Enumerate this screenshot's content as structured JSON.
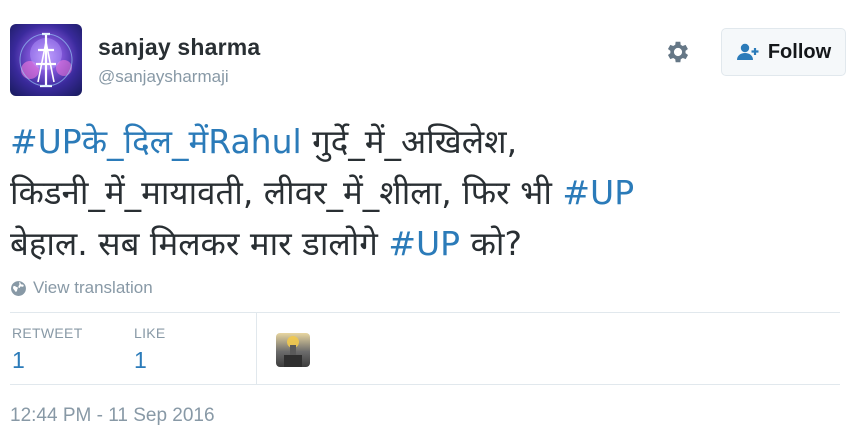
{
  "user": {
    "full_name": "sanjay sharma",
    "handle": "@sanjaysharmaji"
  },
  "actions": {
    "follow_label": "Follow",
    "settings_icon": "gear-icon",
    "follow_icon": "add-user-icon"
  },
  "tweet": {
    "parts": [
      "#UPके_दिल_में",
      "Rahul",
      " गुर्दे_में_अखिलेश,\nकिडनी_में_मायावती, लीवर_में_शीला, फिर भी ",
      "#UP",
      "\nबेहाल. सब मिलकर मार डालोगे ",
      "#UP",
      " को?"
    ]
  },
  "translate": {
    "label": "View translation",
    "icon": "globe-icon"
  },
  "stats": {
    "retweet_label": "RETWEET",
    "retweet_count": "1",
    "like_label": "LIKE",
    "like_count": "1"
  },
  "timestamp": "12:44 PM - 11 Sep 2016",
  "colors": {
    "link": "#2b7bb9",
    "text": "#292f33",
    "muted": "#8899a6",
    "border": "#e1e8ed"
  }
}
